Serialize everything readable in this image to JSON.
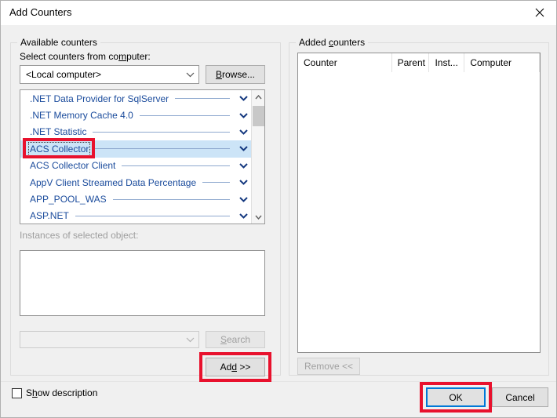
{
  "window": {
    "title": "Add Counters",
    "close_icon": "close-icon"
  },
  "available_group": {
    "legend": "Available counters",
    "select_label_pre": "Select counters from co",
    "select_label_mnemonic": "m",
    "select_label_post": "puter:",
    "computer_combo_value": "<Local computer>",
    "browse_button": "Browse...",
    "browse_mnemonic": "B",
    "instances_label": "Instances of selected object:",
    "instances_items": [],
    "search_combo_value": "",
    "search_button": "Search",
    "search_mnemonic": "S",
    "add_button_pre": "Ad",
    "add_button_mnemonic": "d",
    "add_button_post": " >>",
    "add_button_full": "Add >>",
    "counters": [
      {
        "name": ".NET Data Provider for SqlServer",
        "selected": false,
        "expand_icon": "chevron-down-icon"
      },
      {
        "name": ".NET Memory Cache 4.0",
        "selected": false,
        "expand_icon": "chevron-down-icon"
      },
      {
        "name": ".NET Statistic",
        "selected": false,
        "expand_icon": "chevron-down-icon"
      },
      {
        "name": "ACS Collector",
        "selected": true,
        "expand_icon": "chevron-down-icon"
      },
      {
        "name": "ACS Collector Client",
        "selected": false,
        "expand_icon": "chevron-down-icon"
      },
      {
        "name": "AppV Client Streamed Data Percentage",
        "selected": false,
        "expand_icon": "chevron-down-icon"
      },
      {
        "name": "APP_POOL_WAS",
        "selected": false,
        "expand_icon": "chevron-down-icon"
      },
      {
        "name": "ASP.NET",
        "selected": false,
        "expand_icon": "chevron-down-icon"
      }
    ],
    "scrollbar": {
      "up_icon": "scroll-up-arrow-icon",
      "down_icon": "scroll-down-arrow-icon"
    }
  },
  "added_group": {
    "legend_pre": "Added ",
    "legend_mnemonic": "c",
    "legend_post": "ounters",
    "legend_full": "Added counters",
    "columns": [
      "Counter",
      "Parent",
      "Inst...",
      "Computer"
    ],
    "rows": [],
    "remove_button_pre": "",
    "remove_button_mnemonic": "R",
    "remove_button_post": "emove <<",
    "remove_button_full": "Remove <<"
  },
  "footer": {
    "show_description_pre": "S",
    "show_description_mnemonic": "h",
    "show_description_post": "ow description",
    "show_description_full": "Show description",
    "show_description_checked": false,
    "ok_button": "OK",
    "cancel_button": "Cancel"
  },
  "colors": {
    "dialog_bg": "#f0f0f0",
    "counter_text": "#1a4b9c",
    "selection_bg": "#cce4f7",
    "annotation_red": "#e8112d",
    "focus_blue": "#0078d7"
  }
}
